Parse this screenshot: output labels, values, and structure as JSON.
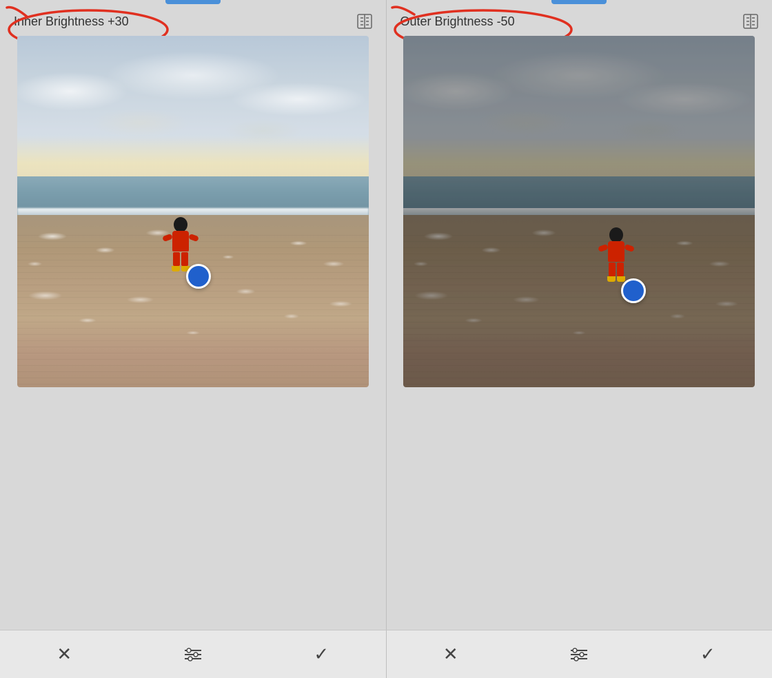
{
  "left_panel": {
    "title": "Inner Brightness +30",
    "icon": "split-view-icon",
    "tab_active": true
  },
  "right_panel": {
    "title": "Outer Brightness -50",
    "icon": "split-view-icon",
    "tab_active": true
  },
  "left_toolbar": {
    "cancel_label": "✕",
    "adjust_label": "⊞",
    "confirm_label": "✓"
  },
  "right_toolbar": {
    "cancel_label": "✕",
    "adjust_label": "⊞",
    "confirm_label": "✓"
  },
  "colors": {
    "blue_tab": "#4a90d9",
    "red_annotation": "#e03020",
    "blue_handle": "#2060cc",
    "background": "#d8d8d8",
    "toolbar_bg": "#e8e8e8"
  }
}
